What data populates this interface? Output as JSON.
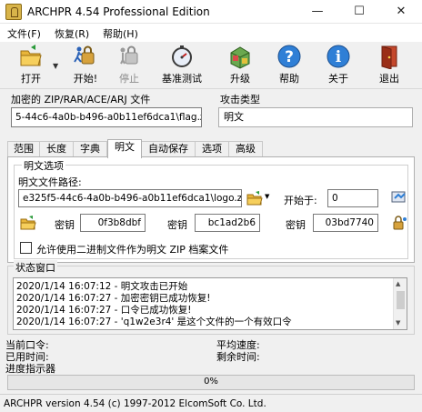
{
  "window": {
    "title": "ARCHPR 4.54 Professional Edition",
    "minimize": "—",
    "maximize": "☐",
    "close": "✕"
  },
  "menu": [
    "文件(F)",
    "恢复(R)",
    "帮助(H)"
  ],
  "toolbar": {
    "open": "打开",
    "start": "开始!",
    "stop": "停止",
    "benchmark": "基准测试",
    "upgrade": "升级",
    "help": "帮助",
    "about": "关于",
    "exit": "退出"
  },
  "file_section": {
    "label": "加密的 ZIP/RAR/ACE/ARJ 文件",
    "path": "5-44c6-4a0b-b496-a0b11ef6dca1\\flag.zip"
  },
  "attack": {
    "label": "攻击类型",
    "selected": "明文"
  },
  "tabs": [
    "范围",
    "长度",
    "字典",
    "明文",
    "自动保存",
    "选项",
    "高级"
  ],
  "plaintext": {
    "group_title": "明文选项",
    "path_label": "明文文件路径:",
    "path_value": "e325f5-44c6-4a0b-b496-a0b11ef6dca1\\logo.zip",
    "start_label": "开始于:",
    "start_value": "0",
    "key_label": "密钥",
    "key1": "0f3b8dbf",
    "key2": "bc1ad2b6",
    "key3": "03bd7740",
    "checkbox_label": "允许使用二进制文件作为明文 ZIP 档案文件"
  },
  "status": {
    "title": "状态窗口",
    "log": [
      "2020/1/14 16:07:12 - 明文攻击已开始",
      "2020/1/14 16:07:27 - 加密密钥已成功恢复!",
      "2020/1/14 16:07:27 - 口令已成功恢复!",
      "2020/1/14 16:07:27 - 'q1w2e3r4' 是这个文件的一个有效口令"
    ]
  },
  "info": {
    "current_password": "当前口令:",
    "avg_speed": "平均速度:",
    "elapsed": "已用时间:",
    "remaining": "剩余时间:",
    "progress_label": "进度指示器"
  },
  "progress": {
    "value": 0,
    "text": "0%"
  },
  "statusbar": "ARCHPR version 4.54 (c) 1997-2012 ElcomSoft Co. Ltd.",
  "colors": {
    "progress": "#06b025",
    "accent": "#0078d7"
  }
}
